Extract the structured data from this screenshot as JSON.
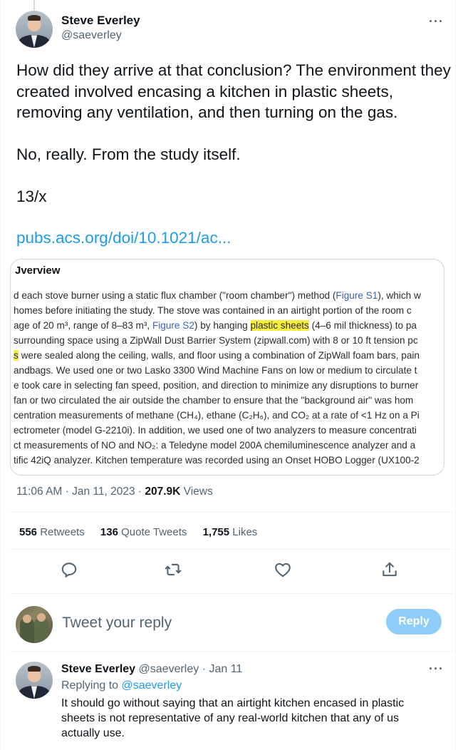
{
  "tweet": {
    "author_name": "Steve Everley",
    "author_handle": "@saeverley",
    "more_icon": "more-horizontal-icon",
    "paragraphs": [
      "How did they arrive at that conclusion? The environment they created involved encasing a kitchen in plastic sheets, removing any ventilation, and then turning on the gas.",
      "No, really. From the study itself.",
      "13/x"
    ],
    "link": "pubs.acs.org/doi/10.1021/ac...",
    "media": {
      "heading": "Jverview",
      "lines": [
        "d each stove burner using a static flux chamber (\"room chamber\") method (Figure S1), which w",
        " homes before initiating the study. The stove was contained in an airtight portion of the room c",
        "age of 20 m³, range of 8–83 m³, Figure S2) by hanging plastic sheets (4–6 mil thickness) to pa",
        "surrounding space using a ZipWall Dust Barrier System (zipwall.com) with 8 or 10 ft tension pc",
        "s were sealed along the ceiling, walls, and floor using a combination of ZipWall foam bars, pain",
        "andbags. We used one or two Lasko 3300 Wind Machine Fans on low or medium to circulate t",
        "e took care in selecting fan speed, position, and direction to minimize any disruptions to burner",
        " fan or two circulated the air outside the chamber to ensure that the \"background air\" was hom",
        "centration measurements of methane (CH₄), ethane (C₂H₆), and CO₂ at a rate of <1 Hz on a Pi",
        "ectrometer (model G-2210i). In addition, we used one of two analyzers to measure concentrati",
        "ct measurements of NO and NO₂: a Teledyne model 200A chemiluminescence analyzer and a",
        "tific 42iQ analyzer. Kitchen temperature was recorded using an Onset HOBO Logger (UX100-2"
      ],
      "fig_s1": "Figure S1",
      "fig_s2": "Figure S2",
      "highlight": "plastic sheets"
    },
    "timestamp": "11:06 AM · Jan 11, 2023 · ",
    "views_count": "207.9K",
    "views_label": " Views",
    "stats": {
      "retweets_count": "556",
      "retweets_label": " Retweets",
      "quotes_count": "136",
      "quotes_label": " Quote Tweets",
      "likes_count": "1,755",
      "likes_label": " Likes"
    },
    "actions": [
      "reply-icon",
      "retweet-icon",
      "like-icon",
      "share-icon"
    ]
  },
  "reply_composer": {
    "placeholder": "Tweet your reply",
    "button_label": "Reply"
  },
  "reply": {
    "author_name": "Steve Everley",
    "author_handle": "@saeverley",
    "date": " · Jan 11",
    "replying_prefix": "Replying to ",
    "replying_to": "@saeverley",
    "text": "It should go without saying that an airtight kitchen encased in plastic sheets is not representative of any real-world kitchen that any of us actually use."
  },
  "colors": {
    "accent": "#1d9bf0",
    "reply_button_disabled": "#8ecdf7",
    "secondary_text": "#536471",
    "highlight": "#f9ef3b"
  }
}
